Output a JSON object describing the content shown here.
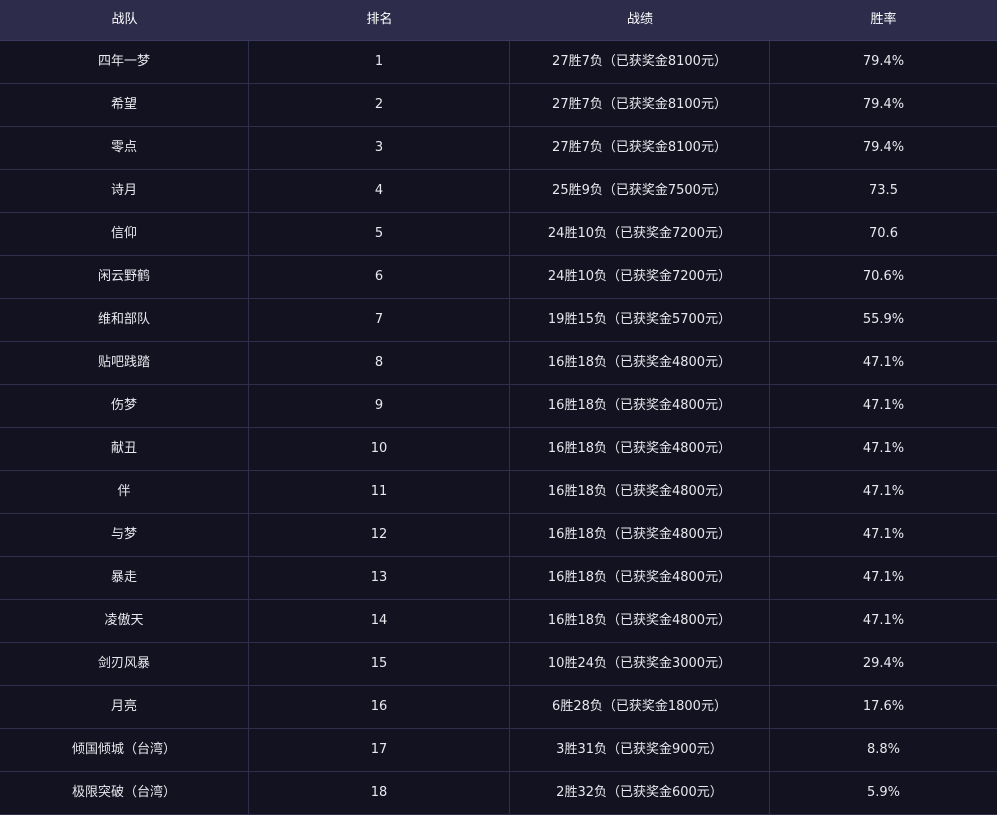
{
  "table": {
    "headers": {
      "team": "战队",
      "rank": "排名",
      "record": "战绩",
      "win_rate": "胜率"
    },
    "rows": [
      {
        "team": "四年一梦",
        "rank": "1",
        "record": "27胜7负（已获奖金8100元）",
        "win_rate": "79.4%"
      },
      {
        "team": "希望",
        "rank": "2",
        "record": "27胜7负（已获奖金8100元）",
        "win_rate": "79.4%"
      },
      {
        "team": "零点",
        "rank": "3",
        "record": "27胜7负（已获奖金8100元）",
        "win_rate": "79.4%"
      },
      {
        "team": "诗月",
        "rank": "4",
        "record": "25胜9负（已获奖金7500元）",
        "win_rate": "73.5"
      },
      {
        "team": "信仰",
        "rank": "5",
        "record": "24胜10负（已获奖金7200元）",
        "win_rate": "70.6"
      },
      {
        "team": "闲云野鹤",
        "rank": "6",
        "record": "24胜10负（已获奖金7200元）",
        "win_rate": "70.6%"
      },
      {
        "team": "维和部队",
        "rank": "7",
        "record": "19胜15负（已获奖金5700元）",
        "win_rate": "55.9%"
      },
      {
        "team": "贴吧践踏",
        "rank": "8",
        "record": "16胜18负（已获奖金4800元）",
        "win_rate": "47.1%"
      },
      {
        "team": "伤梦",
        "rank": "9",
        "record": "16胜18负（已获奖金4800元）",
        "win_rate": "47.1%"
      },
      {
        "team": "献丑",
        "rank": "10",
        "record": "16胜18负（已获奖金4800元）",
        "win_rate": "47.1%"
      },
      {
        "team": "伴",
        "rank": "11",
        "record": "16胜18负（已获奖金4800元）",
        "win_rate": "47.1%"
      },
      {
        "team": "与梦",
        "rank": "12",
        "record": "16胜18负（已获奖金4800元）",
        "win_rate": "47.1%"
      },
      {
        "team": "暴走",
        "rank": "13",
        "record": "16胜18负（已获奖金4800元）",
        "win_rate": "47.1%"
      },
      {
        "team": "凌傲天",
        "rank": "14",
        "record": "16胜18负（已获奖金4800元）",
        "win_rate": "47.1%"
      },
      {
        "team": "剑刃风暴",
        "rank": "15",
        "record": "10胜24负（已获奖金3000元）",
        "win_rate": "29.4%"
      },
      {
        "team": "月亮",
        "rank": "16",
        "record": "6胜28负（已获奖金1800元）",
        "win_rate": "17.6%"
      },
      {
        "team": "倾国倾城（台湾）",
        "rank": "17",
        "record": "3胜31负（已获奖金900元）",
        "win_rate": "8.8%"
      },
      {
        "team": "极限突破（台湾）",
        "rank": "18",
        "record": "2胜32负（已获奖金600元）",
        "win_rate": "5.9%"
      }
    ]
  },
  "colors": {
    "header_background": "#2d2c4a",
    "row_background": "#121220",
    "grid_line": "#2f2e4c",
    "text": "#e8e8ee"
  }
}
